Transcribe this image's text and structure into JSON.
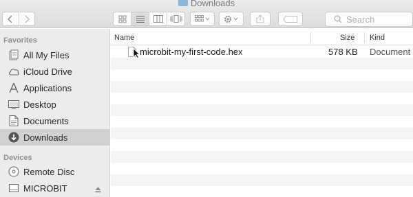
{
  "window": {
    "title": "Downloads"
  },
  "toolbar": {
    "back_icon": "chevron-left-icon",
    "forward_icon": "chevron-right-icon",
    "view_modes": [
      "icon-view",
      "list-view",
      "column-view",
      "cover-flow-view"
    ],
    "active_view": "list-view",
    "search_placeholder": "Search"
  },
  "sidebar": {
    "favorites_heading": "Favorites",
    "favorites": [
      {
        "label": "All My Files",
        "icon": "all-files-icon"
      },
      {
        "label": "iCloud Drive",
        "icon": "cloud-icon"
      },
      {
        "label": "Applications",
        "icon": "applications-icon"
      },
      {
        "label": "Desktop",
        "icon": "desktop-icon"
      },
      {
        "label": "Documents",
        "icon": "documents-icon"
      },
      {
        "label": "Downloads",
        "icon": "downloads-icon",
        "selected": true
      }
    ],
    "devices_heading": "Devices",
    "devices": [
      {
        "label": "Remote Disc",
        "icon": "remote-disc-icon"
      },
      {
        "label": "MICROBIT",
        "icon": "drive-icon",
        "ejectable": true
      }
    ]
  },
  "file_list": {
    "columns": {
      "name": "Name",
      "size": "Size",
      "kind": "Kind"
    },
    "files": [
      {
        "name": "microbit-my-first-code.hex",
        "size": "578 KB",
        "kind": "Document"
      }
    ]
  },
  "colors": {
    "sidebar_bg": "#ececec",
    "selected_bg": "#d1d1d1",
    "alt_row": "#f4f5f5",
    "toolbar_bg": "#dcdcdc"
  }
}
